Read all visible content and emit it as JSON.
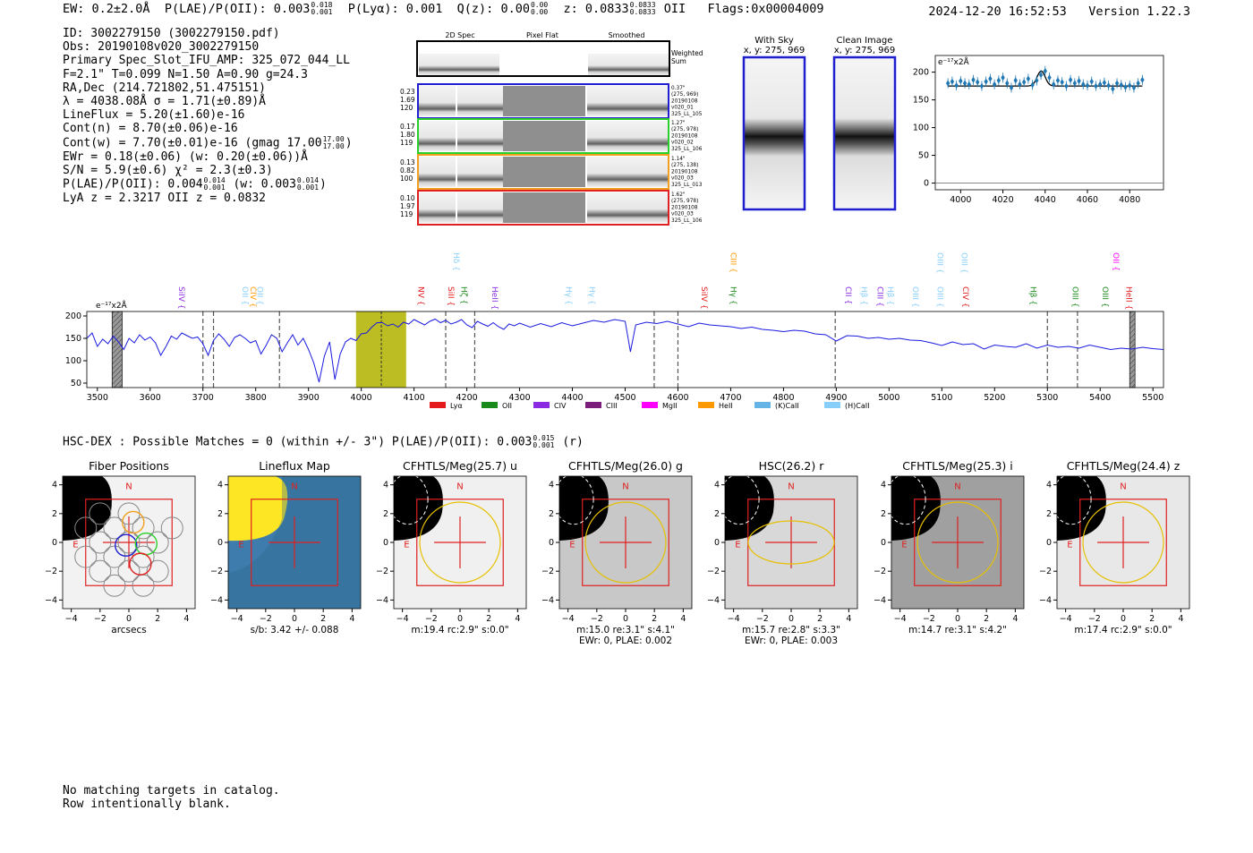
{
  "header": {
    "ew": "EW: 0.2±2.0Å",
    "plae_label": "P(LAE)/P(OII): 0.003",
    "plae_hi": "0.018",
    "plae_lo": "0.001",
    "plya": "P(Lyα): 0.001",
    "qz_label": "Q(z): 0.00",
    "qz_hi": "0.00",
    "qz_lo": "0.00",
    "z_label": "z: 0.0833",
    "z_hi": "0.0833",
    "z_lo": "0.0833",
    "z_line": "OII",
    "flags": "Flags:0x00004009",
    "timestamp": "2024-12-20 16:52:53",
    "version": "Version 1.22.3"
  },
  "info": {
    "id": "ID: 3002279150 (3002279150.pdf)",
    "obs": "Obs: 20190108v020_3002279150",
    "slot": "Primary Spec_Slot_IFU_AMP: 325_072_044_LL",
    "fit": "F=2.1\"  T=0.099  N=1.50  A=0.90  g=24.3",
    "radec": "RA,Dec (214.721802,51.475151)",
    "lambda": "λ = 4038.08Å  σ = 1.71(±0.89)Å",
    "lineflux": "LineFlux = 5.20(±1.60)e-16",
    "contn": "Cont(n) = 8.70(±0.06)e-16",
    "contw_label": "Cont(w) = 7.70(±0.01)e-16 (gmag 17.00",
    "contw_hi": "17.00",
    "contw_lo": "17.00",
    "contw_end": ")",
    "ewr": "EWr = 0.18(±0.06) (w: 0.20(±0.06))Å",
    "sn": "S/N = 5.9(±0.6)  χ² = 2.3(±0.3)",
    "plae_label": "P(LAE)/P(OII): 0.004",
    "plae_hi": "0.014",
    "plae_lo": "0.001",
    "plae_w": "(w: 0.003",
    "plae_w_hi": "0.014",
    "plae_w_lo": "0.001",
    "plae_end": ")",
    "lya": "LyA z = 2.3217   OII z = 0.0832"
  },
  "cutouts": {
    "headers": [
      "2D Spec",
      "Pixel Flat",
      "Smoothed"
    ],
    "weighted_label": "Weighted\nSum",
    "rows": [
      {
        "left": [
          "0.23",
          "1.69",
          "120"
        ],
        "right": [
          "0.37\"",
          "(275, 969)",
          "20190108",
          "v020_01",
          "325_LL_105"
        ],
        "color": "#1f1fd0"
      },
      {
        "left": [
          "0.17",
          "1.80",
          "119"
        ],
        "right": [
          "1.27\"",
          "(275, 978)",
          "20190108",
          "v020_02",
          "325_LL_106"
        ],
        "color": "#2ad02a"
      },
      {
        "left": [
          "0.13",
          "0.82",
          "100"
        ],
        "right": [
          "1.14\"",
          "(275, 138)",
          "20190108",
          "v020_03",
          "325_LL_013"
        ],
        "color": "#f0a020"
      },
      {
        "left": [
          "0.10",
          "1.97",
          "119"
        ],
        "right": [
          "1.62\"",
          "(275, 978)",
          "20190108",
          "v020_03",
          "325_LL_106"
        ],
        "color": "#e02020"
      }
    ]
  },
  "sky_panels": [
    {
      "title": "With Sky",
      "coords": "x, y: 275, 969"
    },
    {
      "title": "Clean Image",
      "coords": "x, y: 275, 969"
    }
  ],
  "zoom_chart": {
    "type": "scatter",
    "unit": "e⁻¹⁷x2Å",
    "xlim": [
      3988,
      4096
    ],
    "ylim": [
      -12,
      230
    ],
    "xticks": [
      4000,
      4020,
      4040,
      4060,
      4080
    ],
    "yticks": [
      0,
      50,
      100,
      150,
      200
    ],
    "points_x": [
      3994,
      3996,
      3998,
      4000,
      4002,
      4004,
      4006,
      4008,
      4010,
      4012,
      4014,
      4016,
      4018,
      4020,
      4022,
      4024,
      4026,
      4028,
      4030,
      4032,
      4034,
      4036,
      4038,
      4040,
      4042,
      4044,
      4046,
      4048,
      4050,
      4052,
      4054,
      4056,
      4058,
      4060,
      4062,
      4064,
      4066,
      4068,
      4070,
      4072,
      4074,
      4076,
      4078,
      4080,
      4082,
      4084,
      4086
    ],
    "points_y": [
      180,
      183,
      176,
      184,
      180,
      178,
      186,
      182,
      175,
      183,
      188,
      178,
      185,
      190,
      180,
      172,
      185,
      178,
      182,
      188,
      177,
      185,
      195,
      202,
      190,
      178,
      185,
      182,
      175,
      186,
      180,
      184,
      178,
      176,
      183,
      175,
      178,
      181,
      176,
      170,
      180,
      177,
      173,
      176,
      172,
      180,
      186
    ],
    "fit_baseline": 175,
    "fit_peak": 27,
    "fit_center": 4038.1,
    "fit_sigma": 1.9
  },
  "chart_data": {
    "type": "line",
    "unit": "e⁻¹⁷x2Å",
    "xlim": [
      3480,
      5520
    ],
    "ylim": [
      40,
      210
    ],
    "xticks": [
      3500,
      3600,
      3700,
      3800,
      3900,
      4000,
      4100,
      4200,
      4300,
      4400,
      4500,
      4600,
      4700,
      4800,
      4900,
      5000,
      5100,
      5200,
      5300,
      5400,
      5500
    ],
    "yticks": [
      50,
      100,
      150,
      200
    ],
    "highlight_band": [
      3990,
      4085
    ],
    "detection_line": 4038,
    "hatched_regions": [
      [
        3528,
        3547
      ],
      [
        5456,
        5466
      ]
    ],
    "dashed_lines": [
      3700,
      3720,
      3845,
      4160,
      4215,
      4555,
      4600,
      4898,
      5300,
      5357
    ],
    "x": [
      3480,
      3490,
      3500,
      3510,
      3520,
      3530,
      3540,
      3550,
      3560,
      3570,
      3580,
      3590,
      3600,
      3610,
      3620,
      3630,
      3640,
      3650,
      3660,
      3670,
      3680,
      3690,
      3700,
      3710,
      3720,
      3730,
      3740,
      3750,
      3760,
      3770,
      3780,
      3790,
      3800,
      3810,
      3820,
      3830,
      3840,
      3850,
      3860,
      3870,
      3880,
      3890,
      3900,
      3910,
      3920,
      3930,
      3940,
      3950,
      3960,
      3970,
      3980,
      3990,
      4000,
      4010,
      4020,
      4030,
      4040,
      4050,
      4060,
      4070,
      4080,
      4090,
      4100,
      4110,
      4120,
      4130,
      4140,
      4150,
      4160,
      4170,
      4180,
      4190,
      4200,
      4210,
      4220,
      4230,
      4240,
      4250,
      4260,
      4270,
      4280,
      4290,
      4300,
      4320,
      4340,
      4360,
      4380,
      4400,
      4420,
      4440,
      4460,
      4480,
      4500,
      4510,
      4520,
      4540,
      4560,
      4580,
      4600,
      4620,
      4640,
      4660,
      4680,
      4700,
      4720,
      4740,
      4760,
      4780,
      4800,
      4820,
      4840,
      4860,
      4880,
      4900,
      4920,
      4940,
      4960,
      4980,
      5000,
      5020,
      5040,
      5060,
      5080,
      5100,
      5120,
      5140,
      5160,
      5180,
      5200,
      5220,
      5240,
      5260,
      5280,
      5300,
      5320,
      5340,
      5360,
      5380,
      5400,
      5420,
      5440,
      5460,
      5480,
      5500,
      5520
    ],
    "y": [
      150,
      162,
      132,
      148,
      138,
      155,
      142,
      125,
      150,
      140,
      158,
      146,
      153,
      140,
      112,
      132,
      155,
      148,
      162,
      156,
      150,
      153,
      138,
      112,
      145,
      160,
      148,
      132,
      152,
      158,
      150,
      140,
      145,
      115,
      135,
      158,
      150,
      120,
      140,
      158,
      135,
      150,
      125,
      95,
      52,
      110,
      142,
      58,
      115,
      142,
      150,
      145,
      160,
      162,
      175,
      185,
      185,
      178,
      182,
      175,
      186,
      182,
      192,
      186,
      180,
      188,
      193,
      185,
      190,
      182,
      186,
      192,
      180,
      174,
      188,
      182,
      177,
      185,
      176,
      170,
      182,
      178,
      184,
      175,
      183,
      176,
      185,
      178,
      184,
      190,
      186,
      192,
      188,
      120,
      180,
      186,
      183,
      188,
      182,
      176,
      184,
      180,
      178,
      176,
      172,
      175,
      170,
      168,
      165,
      168,
      166,
      160,
      158,
      144,
      156,
      155,
      150,
      152,
      148,
      150,
      146,
      145,
      140,
      134,
      142,
      136,
      138,
      126,
      135,
      132,
      130,
      138,
      128,
      135,
      130,
      132,
      128,
      135,
      130,
      125,
      128,
      126,
      130,
      127,
      125
    ]
  },
  "legend": [
    {
      "label": "Lyα",
      "color": "#e41a1c"
    },
    {
      "label": "OII",
      "color": "#1a8a1a"
    },
    {
      "label": "CIV",
      "color": "#8a2be2"
    },
    {
      "label": "CIII",
      "color": "#7b1d7b"
    },
    {
      "label": "MgII",
      "color": "#ff00ff"
    },
    {
      "label": "HeII",
      "color": "#ff9900"
    },
    {
      "label": "(K)CaII",
      "color": "#66b3e6"
    },
    {
      "label": "(H)CaII",
      "color": "#87cefa"
    }
  ],
  "line_labels": [
    {
      "text": "SiIV",
      "x": 3655,
      "row": 2,
      "color": "#8a2be2"
    },
    {
      "text": "OII",
      "x": 3775,
      "row": 2,
      "color": "#87cefa"
    },
    {
      "text": "CIV",
      "x": 3790,
      "row": 2,
      "color": "#ff9900"
    },
    {
      "text": "OII",
      "x": 3803,
      "row": 2,
      "color": "#87cefa"
    },
    {
      "text": "Hδ",
      "x": 4175,
      "row": 0,
      "color": "#87cefa"
    },
    {
      "text": "NV",
      "x": 4108,
      "row": 2,
      "color": "#e41a1c"
    },
    {
      "text": "SiII",
      "x": 4165,
      "row": 2,
      "color": "#e41a1c"
    },
    {
      "text": "Hζ",
      "x": 4190,
      "row": 2,
      "color": "#1a8a1a"
    },
    {
      "text": "HeII",
      "x": 4248,
      "row": 2,
      "color": "#8a2be2"
    },
    {
      "text": "Hγ",
      "x": 4388,
      "row": 2,
      "color": "#87cefa"
    },
    {
      "text": "Hγ",
      "x": 4432,
      "row": 2,
      "color": "#87cefa"
    },
    {
      "text": "CIII",
      "x": 4700,
      "row": 0,
      "color": "#ff9900"
    },
    {
      "text": "SiIV",
      "x": 4645,
      "row": 2,
      "color": "#e41a1c"
    },
    {
      "text": "Hγ",
      "x": 4700,
      "row": 2,
      "color": "#1a8a1a"
    },
    {
      "text": "CII",
      "x": 4918,
      "row": 2,
      "color": "#8a2be2"
    },
    {
      "text": "Hβ",
      "x": 4948,
      "row": 2,
      "color": "#87cefa"
    },
    {
      "text": "CIII",
      "x": 4978,
      "row": 2,
      "color": "#8a2be2"
    },
    {
      "text": "Hβ",
      "x": 4998,
      "row": 2,
      "color": "#87cefa"
    },
    {
      "text": "OIII",
      "x": 5045,
      "row": 2,
      "color": "#87cefa"
    },
    {
      "text": "OIII",
      "x": 5092,
      "row": 2,
      "color": "#87cefa"
    },
    {
      "text": "OIII",
      "x": 5092,
      "row": 0,
      "color": "#87cefa"
    },
    {
      "text": "OIII",
      "x": 5138,
      "row": 0,
      "color": "#87cefa"
    },
    {
      "text": "CIV",
      "x": 5140,
      "row": 2,
      "color": "#e41a1c"
    },
    {
      "text": "Hβ",
      "x": 5268,
      "row": 2,
      "color": "#1a8a1a"
    },
    {
      "text": "OII",
      "x": 5425,
      "row": 0,
      "color": "#ff00ff"
    },
    {
      "text": "OIII",
      "x": 5348,
      "row": 2,
      "color": "#1a8a1a"
    },
    {
      "text": "OIII",
      "x": 5405,
      "row": 2,
      "color": "#1a8a1a"
    },
    {
      "text": "HeII",
      "x": 5450,
      "row": 2,
      "color": "#e41a1c"
    }
  ],
  "hsc": {
    "text": "HSC-DEX : Possible Matches = 0 (within +/- 3\")  P(LAE)/P(OII): 0.003",
    "hi": "0.015",
    "lo": "0.001",
    "end": "(r)"
  },
  "imaging": {
    "ticks": [
      -4,
      -2,
      0,
      2,
      4
    ],
    "n_label": "N",
    "e_label": "E",
    "panels": [
      {
        "title": "Fiber Positions",
        "caption": "arcsecs",
        "caption2": ""
      },
      {
        "title": "Lineflux Map",
        "caption": "s/b: 3.42 +/- 0.088",
        "caption2": ""
      },
      {
        "title": "CFHTLS/Meg(25.7) u",
        "caption": "m:19.4 rc:2.9\"  s:0.0\"",
        "caption2": ""
      },
      {
        "title": "CFHTLS/Meg(26.0) g",
        "caption": "m:15.0  re:3.1\"  s:4.1\"",
        "caption2": "EWr: 0, PLAE: 0.002"
      },
      {
        "title": "HSC(26.2) r",
        "caption": "m:15.7  re:2.8\"  s:3.3\"",
        "caption2": "EWr: 0, PLAE: 0.003"
      },
      {
        "title": "CFHTLS/Meg(25.3) i",
        "caption": "m:14.7  re:3.1\"  s:4.2\"",
        "caption2": ""
      },
      {
        "title": "CFHTLS/Meg(24.4) z",
        "caption": "m:17.4 rc:2.9\"  s:0.0\"",
        "caption2": ""
      }
    ]
  },
  "notes": {
    "line1": "No matching targets in catalog.",
    "line2": "Row intentionally blank."
  }
}
